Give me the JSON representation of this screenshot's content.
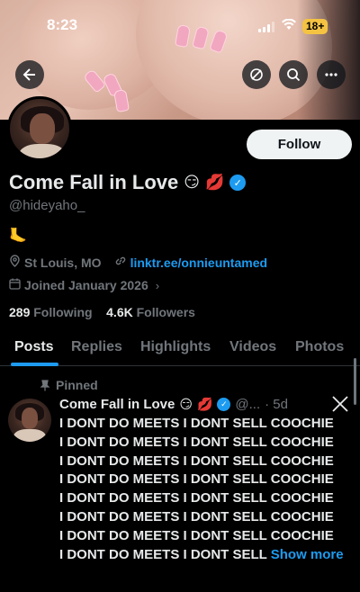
{
  "status_bar": {
    "time": "8:23",
    "battery": "18+"
  },
  "nav": {
    "back_icon": "arrow-left-icon",
    "grok_icon": "grok-icon",
    "search_icon": "search-icon",
    "more_icon": "more-icon"
  },
  "profile": {
    "follow_label": "Follow",
    "name": "Come Fall in Love",
    "name_emojis": [
      "😏",
      "💋"
    ],
    "handle": "@hideyaho_",
    "bio": "🦶",
    "location": "St Louis, MO",
    "link": "linktr.ee/onnieuntamed",
    "joined": "Joined January 2026",
    "following_count": "289",
    "following_label": "Following",
    "followers_count": "4.6K",
    "followers_label": "Followers"
  },
  "tabs": [
    "Posts",
    "Replies",
    "Highlights",
    "Videos",
    "Photos"
  ],
  "post": {
    "pinned_label": "Pinned",
    "author_name": "Come Fall in Love",
    "author_handle": "@...",
    "time": "· 5d",
    "lines": [
      "I DONT DO MEETS I DONT SELL COOCHIE",
      "I DONT DO MEETS I DONT SELL COOCHIE",
      "I DONT DO MEETS I DONT SELL COOCHIE",
      "I DONT DO MEETS I DONT SELL COOCHIE",
      "I DONT DO MEETS I DONT SELL COOCHIE",
      "I DONT DO MEETS I DONT SELL COOCHIE",
      "I DONT DO MEETS I DONT SELL COOCHIE",
      "I DONT DO MEETS I DONT SELL"
    ],
    "show_more": "Show more"
  },
  "colors": {
    "accent": "#1d9bf0",
    "background": "#000000",
    "muted": "#71767b"
  }
}
